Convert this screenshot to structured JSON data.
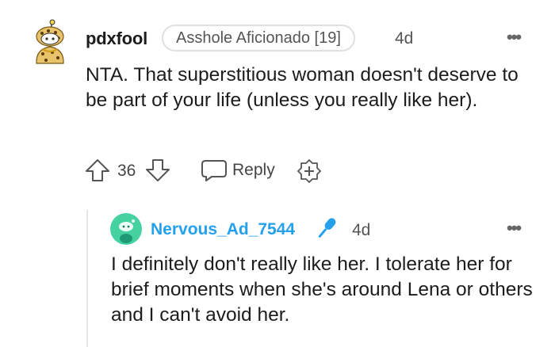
{
  "top_comment": {
    "username": "pdxfool",
    "flair": "Asshole Aficionado [19]",
    "time": "4d",
    "more": "•••",
    "body": "NTA. That superstitious woman doesn't deserve to be part of your life (unless you really like her).",
    "score": "36",
    "reply_label": "Reply",
    "avatar_icon": "snoo-avatar-icon"
  },
  "reply_comment": {
    "username": "Nervous_Ad_7544",
    "time": "4d",
    "more": "•••",
    "body": "I definitely don't really like her. I tolerate her for brief moments when she's around Lena or others and I can't avoid her.",
    "avatar_icon": "snoo-avatar-icon",
    "badge_icon": "microphone-icon"
  },
  "colors": {
    "username_link": "#24a0ed",
    "avatar_teal": "#46d2a0",
    "text": "#1c1c1c",
    "muted": "#555555"
  }
}
